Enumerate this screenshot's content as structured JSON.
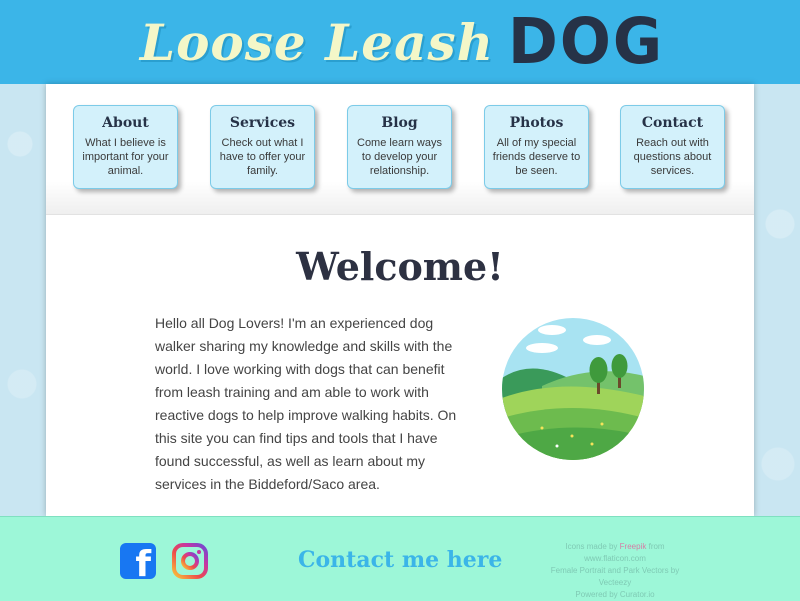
{
  "header": {
    "logo_script": "Loose Leash",
    "logo_bold": "DOG"
  },
  "nav": [
    {
      "title": "About",
      "desc": "What I believe is important for your animal."
    },
    {
      "title": "Services",
      "desc": "Check out what I have to offer your family."
    },
    {
      "title": "Blog",
      "desc": "Come learn ways to develop your relationship."
    },
    {
      "title": "Photos",
      "desc": "All of my special friends deserve to be seen."
    },
    {
      "title": "Contact",
      "desc": "Reach out with questions about services."
    }
  ],
  "main": {
    "heading": "Welcome!",
    "intro": "Hello all Dog Lovers! I'm an experienced dog walker sharing my knowledge and skills with the world. I love working with dogs that can benefit from leash training and am able to work with reactive dogs to help improve walking habits. On this site you can find tips and tools that I have found successful, as well as learn about my services in the Biddeford/Saco area."
  },
  "footer": {
    "contact_label": "Contact me here",
    "credits": {
      "line1_prefix": "Icons made by",
      "line1_author": "Freepik",
      "line1_mid": "from",
      "line1_site": "www.flaticon.com",
      "line2": "Female Portrait  and Park Vectors by Vecteezy",
      "line3": "Powered by Curator.io"
    }
  },
  "icons": {
    "facebook": "facebook-icon",
    "instagram": "instagram-icon"
  },
  "colors": {
    "header_bg": "#3bb5e8",
    "logo_cream": "#f4f7c8",
    "logo_dark": "#263247",
    "nav_card_bg": "#d3f1fb",
    "footer_bg": "#9df7d8",
    "contact_link": "#3bb5e8"
  }
}
